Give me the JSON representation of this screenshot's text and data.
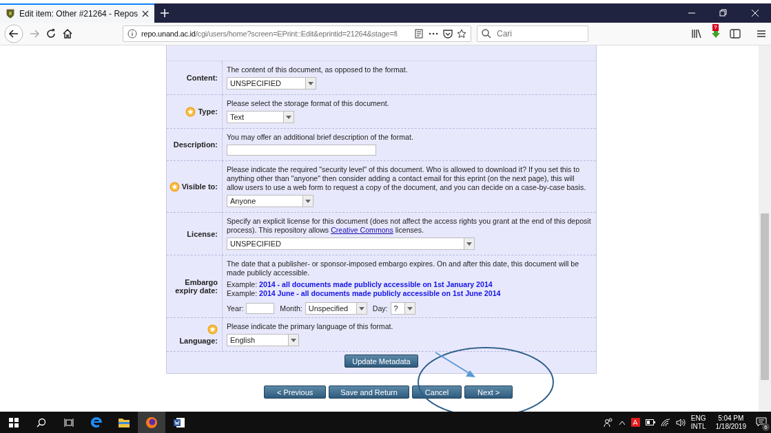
{
  "browser": {
    "tab": {
      "title": "Edit item: Other #21264 - Repos",
      "selected": true
    },
    "url_host": "repo.unand.ac.id",
    "url_path": "/cgi/users/home?screen=EPrint::Edit&eprintid=21264&stage=fi",
    "search": {
      "placeholder": "Cari"
    },
    "download_badge": "?"
  },
  "form": {
    "rows": [
      {
        "label": "Content:",
        "required": false,
        "help": [
          {
            "kind": "text",
            "text": "The content of this document, as opposed to the format."
          }
        ],
        "control": {
          "kind": "select",
          "value": "UNSPECIFIED"
        }
      },
      {
        "label": "Type:",
        "required": true,
        "help": [
          {
            "kind": "text",
            "text": "Please select the storage format of this document."
          }
        ],
        "control": {
          "kind": "select",
          "value": "Text"
        }
      },
      {
        "label": "Description:",
        "required": false,
        "help": [
          {
            "kind": "text",
            "text": "You may offer an additional brief description of the format."
          }
        ],
        "control": {
          "kind": "input"
        }
      },
      {
        "label": "Visible to:",
        "required": true,
        "help": [
          {
            "kind": "text",
            "text": "Please indicate the required \"security level\" of this document. Who is allowed to download it? If you set this to anything other than \"anyone\" then consider adding a contact email for this eprint (on the next page), this will allow users to use a web form to request a copy of the document, and you can decide on a case-by-case basis."
          }
        ],
        "control": {
          "kind": "select",
          "value": "Anyone"
        }
      },
      {
        "label": "License:",
        "required": false,
        "help": [
          {
            "kind": "text",
            "text": "Specify an explicit license for this document (does not affect the access rights you grant at the end of this deposit process). This repository allows"
          },
          {
            "kind": "link",
            "text": "Creative Commons"
          },
          {
            "kind": "text",
            "text": "licenses."
          }
        ],
        "control": {
          "kind": "select",
          "value": "UNSPECIFIED"
        }
      },
      {
        "label": "Embargo expiry date:",
        "required": false,
        "help": [
          {
            "kind": "text",
            "text": "The date that a publisher- or sponsor-imposed embargo expires. On and after this date, this document will be made publicly accessible."
          },
          {
            "kind": "example",
            "text": "Example: **2014 - all documents made publicly accessible on 1st January 2014**"
          },
          {
            "kind": "example",
            "text": "Example: **2014 June - all documents made publicly accessible on 1st June 2014**"
          }
        ],
        "control": {
          "kind": "date",
          "year_label": "Year:",
          "month_label": "Month:",
          "month": "Unspecified",
          "day_label": "Day:",
          "day": "?"
        }
      },
      {
        "label": "Language:",
        "required": true,
        "help": [
          {
            "kind": "text",
            "text": "Please indicate the primary language of this format."
          }
        ],
        "control": {
          "kind": "select",
          "value": "English"
        }
      }
    ],
    "update_button": "Update Metadata"
  },
  "nav_buttons": [
    "< Previous",
    "Save and Return",
    "Cancel",
    "Next >"
  ],
  "taskbar": {
    "lang": "ENG",
    "layout": "INTL",
    "time": "5:04 PM",
    "date": "1/18/2019",
    "notifications": "6"
  }
}
